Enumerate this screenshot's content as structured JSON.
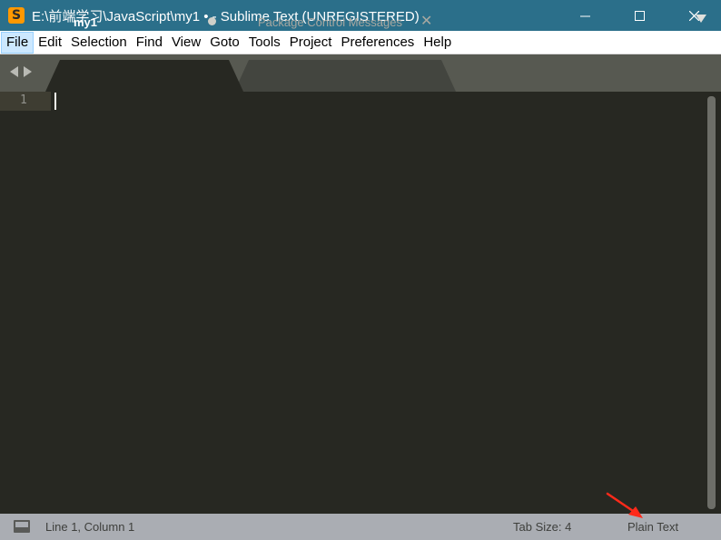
{
  "window": {
    "title": "E:\\前端学习\\JavaScript\\my1 • - Sublime Text (UNREGISTERED)",
    "app_icon_glyph": "S",
    "app_icon_color": "#ff9800",
    "titlebar_color": "#2b6f8a"
  },
  "menu": {
    "items": [
      {
        "label": "File",
        "active": true
      },
      {
        "label": "Edit"
      },
      {
        "label": "Selection"
      },
      {
        "label": "Find"
      },
      {
        "label": "View"
      },
      {
        "label": "Goto"
      },
      {
        "label": "Tools"
      },
      {
        "label": "Project"
      },
      {
        "label": "Preferences"
      },
      {
        "label": "Help"
      }
    ]
  },
  "tabs": {
    "active": {
      "label": "my1",
      "dirty": true
    },
    "inactive": {
      "label": "Package Control Messages",
      "close_glyph": "✕"
    }
  },
  "editor": {
    "line_numbers": [
      "1"
    ],
    "background_color": "#272822"
  },
  "status": {
    "position": "Line 1, Column 1",
    "tab_size": "Tab Size: 4",
    "syntax": "Plain Text"
  },
  "annotation": {
    "arrow_color": "#ff2a1a"
  }
}
